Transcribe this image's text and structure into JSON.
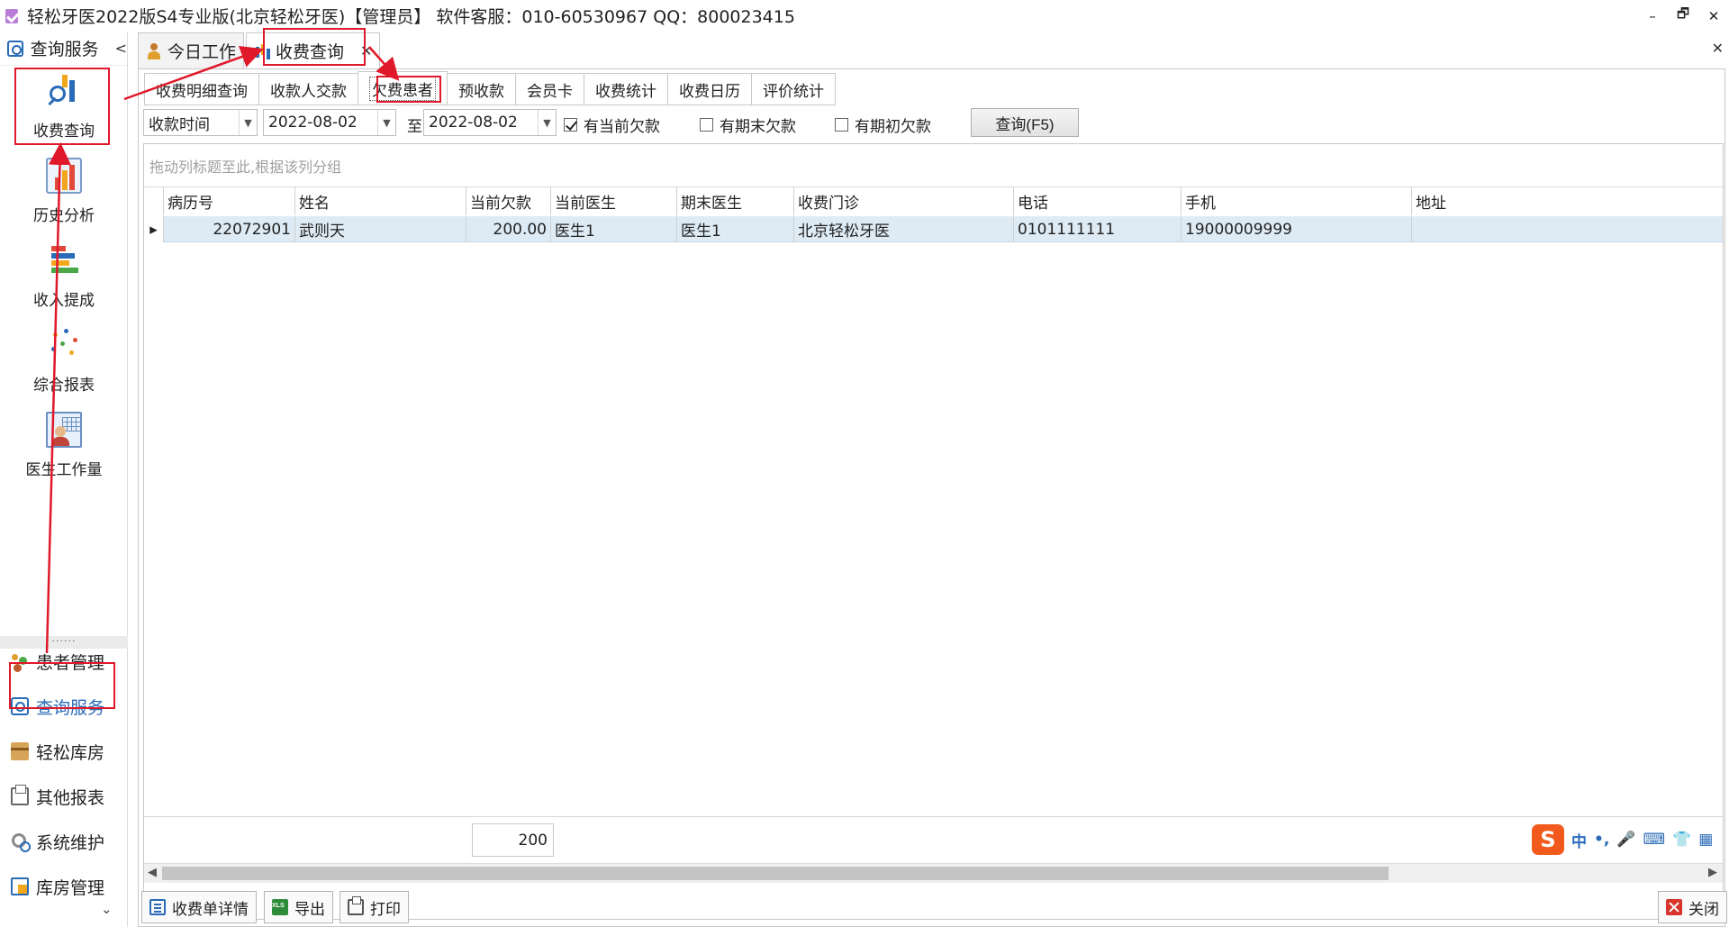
{
  "window": {
    "title": "轻松牙医2022版S4专业版(北京轻松牙医)【管理员】   软件客服：010-60530967 QQ：800023415",
    "minimize_label": "–",
    "restore_label": "🗗",
    "close_label": "✕"
  },
  "sidebar": {
    "header_label": "查询服务",
    "collapse_label": "<",
    "tools": [
      {
        "label": "收费查询",
        "icon": "query-chart-icon"
      },
      {
        "label": "历史分析",
        "icon": "history-chart-icon"
      },
      {
        "label": "收入提成",
        "icon": "income-bars-icon"
      },
      {
        "label": "综合报表",
        "icon": "report-dots-icon"
      },
      {
        "label": "医生工作量",
        "icon": "doctor-workload-icon"
      }
    ],
    "separator": "......",
    "nav": [
      {
        "label": "患者管理",
        "icon": "people-icon"
      },
      {
        "label": "查询服务",
        "icon": "magnifier-icon",
        "active": true
      },
      {
        "label": "轻松库房",
        "icon": "box-icon"
      },
      {
        "label": "其他报表",
        "icon": "printer-icon"
      },
      {
        "label": "系统维护",
        "icon": "gear-icon"
      },
      {
        "label": "库房管理",
        "icon": "store-icon"
      }
    ],
    "more_label": "⌄"
  },
  "doc_tabs": [
    {
      "label": "今日工作",
      "icon": "person-icon"
    },
    {
      "label": "收费查询",
      "icon": "chart-icon",
      "active": true,
      "close": "✕"
    }
  ],
  "close_all_label": "✕",
  "sub_tabs": [
    "收费明细查询",
    "收款人交款",
    "欠费患者",
    "预收款",
    "会员卡",
    "收费统计",
    "收费日历",
    "评价统计"
  ],
  "active_sub_tab": "欠费患者",
  "filter": {
    "field": "收款时间",
    "date_from": "2022-08-02",
    "to_label": "至",
    "date_to": "2022-08-02",
    "checks": [
      {
        "label": "有当前欠款",
        "checked": true
      },
      {
        "label": "有期末欠款",
        "checked": false
      },
      {
        "label": "有期初欠款",
        "checked": false
      }
    ],
    "query_label": "查询(F5)"
  },
  "grid": {
    "group_hint": "拖动列标题至此,根据该列分组",
    "columns": [
      "病历号",
      "姓名",
      "当前欠款",
      "当前医生",
      "期末医生",
      "收费门诊",
      "电话",
      "手机",
      "地址"
    ],
    "rows": [
      [
        "22072901",
        "武则天",
        "200.00",
        "医生1",
        "医生1",
        "北京轻松牙医",
        "0101111111",
        "19000009999",
        ""
      ]
    ],
    "footer_sum": "200",
    "row_indicator": "▸"
  },
  "ime": {
    "logo": "S",
    "items": [
      "中",
      "•,",
      "🎤",
      "⌨",
      "👕",
      "▦"
    ]
  },
  "bottom_buttons": {
    "detail": "收费单详情",
    "export": "导出",
    "print": "打印",
    "close": "关闭"
  },
  "annotation_color": "#e0192a"
}
